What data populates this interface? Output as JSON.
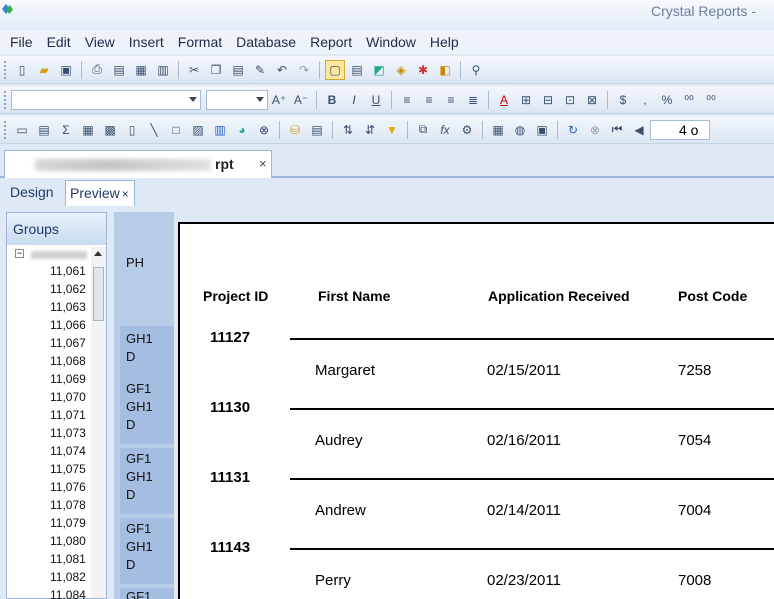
{
  "app": {
    "title": "Crystal Reports -"
  },
  "menu": [
    "File",
    "Edit",
    "View",
    "Insert",
    "Format",
    "Database",
    "Report",
    "Window",
    "Help"
  ],
  "toolbar": {
    "page_value": "4 o"
  },
  "document_tab": {
    "name_suffix": "rpt",
    "close": "×"
  },
  "view_tabs": {
    "design": "Design",
    "preview": "Preview",
    "preview_close": "×"
  },
  "groups_panel": {
    "title": "Groups",
    "collapse_glyph": "−",
    "items": [
      "11,061",
      "11,062",
      "11,063",
      "11,066",
      "11,067",
      "11,068",
      "11,069",
      "11,070",
      "11,071",
      "11,073",
      "11,074",
      "11,075",
      "11,076",
      "11,078",
      "11,079",
      "11,080",
      "11,081",
      "11,082",
      "11,084"
    ]
  },
  "sections": {
    "ph": "PH",
    "bands": [
      [
        "GH1",
        "D"
      ],
      [
        "GF1",
        "GH1",
        "D"
      ],
      [
        "GF1",
        "GH1",
        "D"
      ],
      [
        "GF1",
        "GH1",
        "D"
      ],
      [
        "GF1"
      ]
    ]
  },
  "report": {
    "columns": {
      "project_id": "Project ID",
      "first_name": "First Name",
      "application_received": "Application Received",
      "post_code": "Post Code"
    },
    "groups": [
      {
        "id": "11127",
        "first_name": "Margaret",
        "application_received": "02/15/2011",
        "post_code": "7258"
      },
      {
        "id": "11130",
        "first_name": "Audrey",
        "application_received": "02/16/2011",
        "post_code": "7054"
      },
      {
        "id": "11131",
        "first_name": "Andrew",
        "application_received": "02/14/2011",
        "post_code": "7004"
      },
      {
        "id": "11143",
        "first_name": "Perry",
        "application_received": "02/23/2011",
        "post_code": "7008"
      }
    ]
  }
}
